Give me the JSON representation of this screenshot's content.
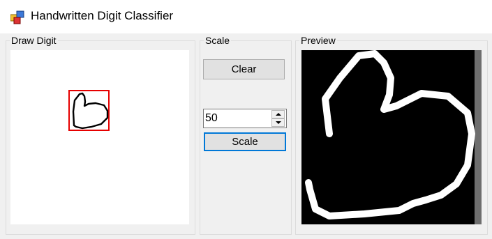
{
  "window": {
    "title": "Handwritten Digit Classifier"
  },
  "groups": {
    "draw": {
      "caption": "Draw Digit"
    },
    "scale": {
      "caption": "Scale"
    },
    "preview": {
      "caption": "Preview"
    }
  },
  "buttons": {
    "clear_label": "Clear",
    "scale_label": "Scale"
  },
  "scale_input": {
    "value": "50"
  },
  "colors": {
    "selection_border": "#e60000",
    "focus_border": "#0078d7",
    "stroke": "#000000",
    "preview_bg": "#000000",
    "preview_stroke": "#ffffff"
  }
}
